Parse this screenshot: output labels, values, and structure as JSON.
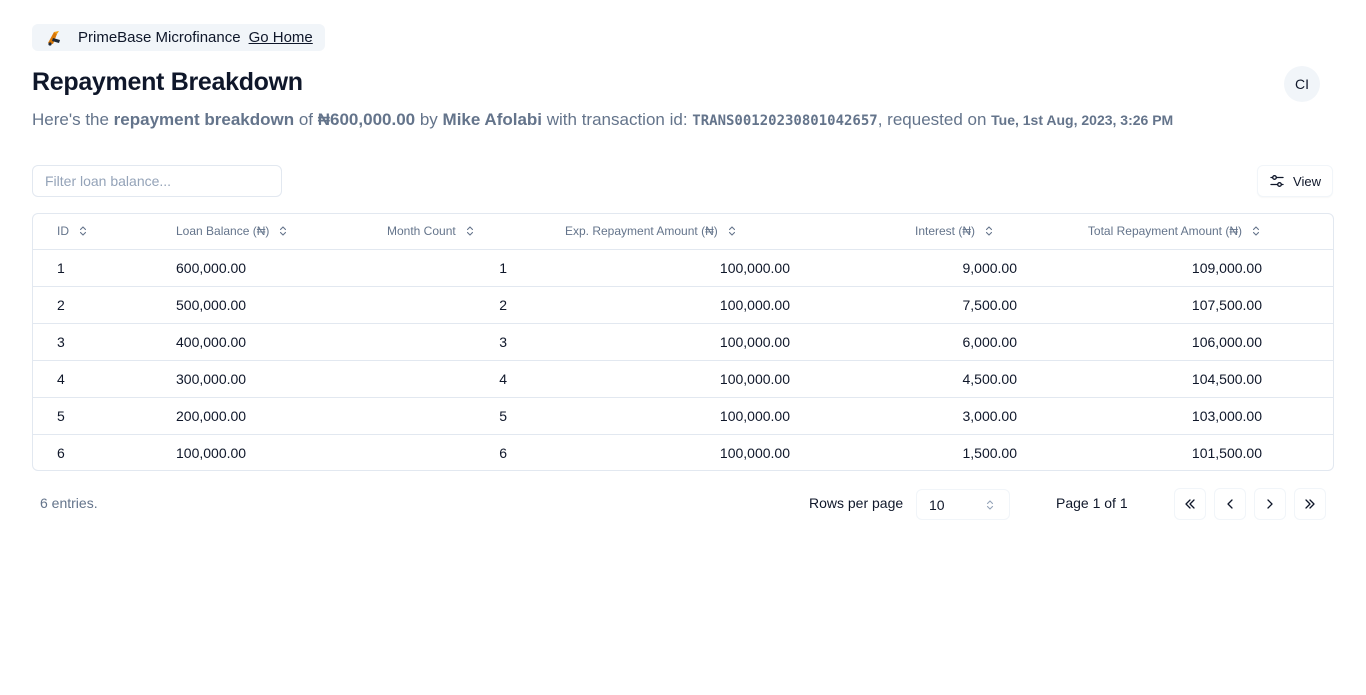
{
  "brand": {
    "name": "PrimeBase Microfinance",
    "home_link": "Go Home"
  },
  "header": {
    "title": "Repayment Breakdown",
    "avatar_initials": "CI"
  },
  "summary": {
    "prefix": "Here's the ",
    "bold_phrase": "repayment breakdown",
    "of": " of ",
    "amount": "₦600,000.00",
    "by": " by ",
    "borrower": "Mike Afolabi",
    "with_tx": " with transaction id: ",
    "transaction_id": "TRANS00120230801042657",
    "requested": ", requested on ",
    "date": "Tue, 1st Aug, 2023, 3:26 PM"
  },
  "toolbar": {
    "filter_placeholder": "Filter loan balance...",
    "view_label": "View"
  },
  "table": {
    "columns": [
      "ID",
      "Loan Balance (₦)",
      "Month Count",
      "Exp. Repayment Amount (₦)",
      "Interest (₦)",
      "Total Repayment Amount (₦)"
    ],
    "rows": [
      [
        "1",
        "600,000.00",
        "1",
        "100,000.00",
        "9,000.00",
        "109,000.00"
      ],
      [
        "2",
        "500,000.00",
        "2",
        "100,000.00",
        "7,500.00",
        "107,500.00"
      ],
      [
        "3",
        "400,000.00",
        "3",
        "100,000.00",
        "6,000.00",
        "106,000.00"
      ],
      [
        "4",
        "300,000.00",
        "4",
        "100,000.00",
        "4,500.00",
        "104,500.00"
      ],
      [
        "5",
        "200,000.00",
        "5",
        "100,000.00",
        "3,000.00",
        "103,000.00"
      ],
      [
        "6",
        "100,000.00",
        "6",
        "100,000.00",
        "1,500.00",
        "101,500.00"
      ]
    ]
  },
  "footer": {
    "entries": "6 entries.",
    "rows_per_page_label": "Rows per page",
    "rows_per_page_value": "10",
    "page_info": "Page 1 of 1"
  }
}
